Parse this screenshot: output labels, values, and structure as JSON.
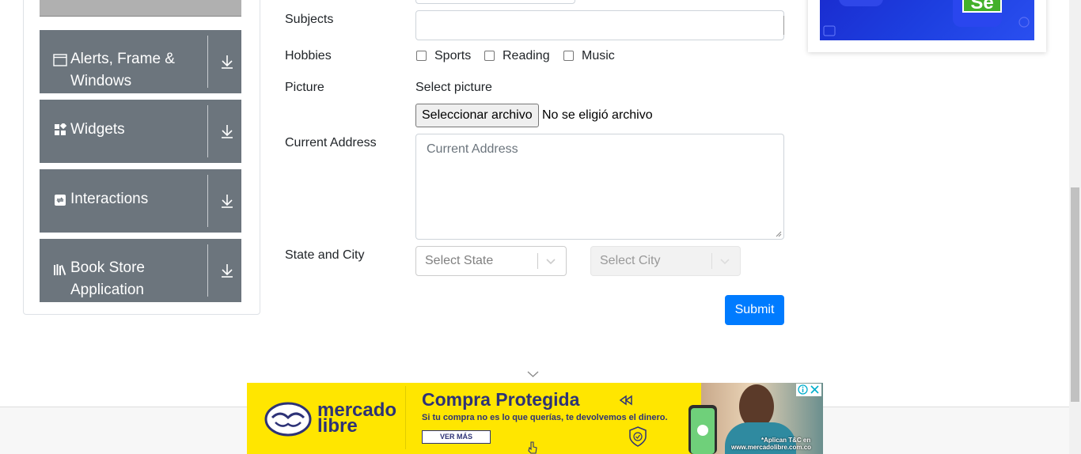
{
  "sidebar": {
    "items": [
      {
        "label": "Alerts, Frame & Windows",
        "icon": "window-icon"
      },
      {
        "label": "Widgets",
        "icon": "widgets-icon"
      },
      {
        "label": "Interactions",
        "icon": "interactions-icon"
      },
      {
        "label": "Book Store Application",
        "icon": "books-icon"
      }
    ]
  },
  "form": {
    "subjects_label": "Subjects",
    "hobbies_label": "Hobbies",
    "hobbies": [
      "Sports",
      "Reading",
      "Music"
    ],
    "picture_label": "Picture",
    "select_picture": "Select picture",
    "file_button": "Seleccionar archivo",
    "file_status": "No se eligió archivo",
    "address_label": "Current Address",
    "address_placeholder": "Current Address",
    "state_city_label": "State and City",
    "state_placeholder": "Select State",
    "city_placeholder": "Select City",
    "submit": "Submit"
  },
  "right_ad": {
    "badge": "Se"
  },
  "bottom_ad": {
    "brand_line1": "mercado",
    "brand_line2": "libre",
    "headline": "Compra Protegida",
    "subline": "Si tu compra no es lo que querías, te devolvemos el dinero.",
    "cta": "VER MÁS",
    "legal_line1": "*Aplican T&C en",
    "legal_line2": "www.mercadolibre.com.co"
  },
  "colors": {
    "primary": "#007bff",
    "sidebar": "#6c757d",
    "ad_yellow": "#ffe600"
  }
}
